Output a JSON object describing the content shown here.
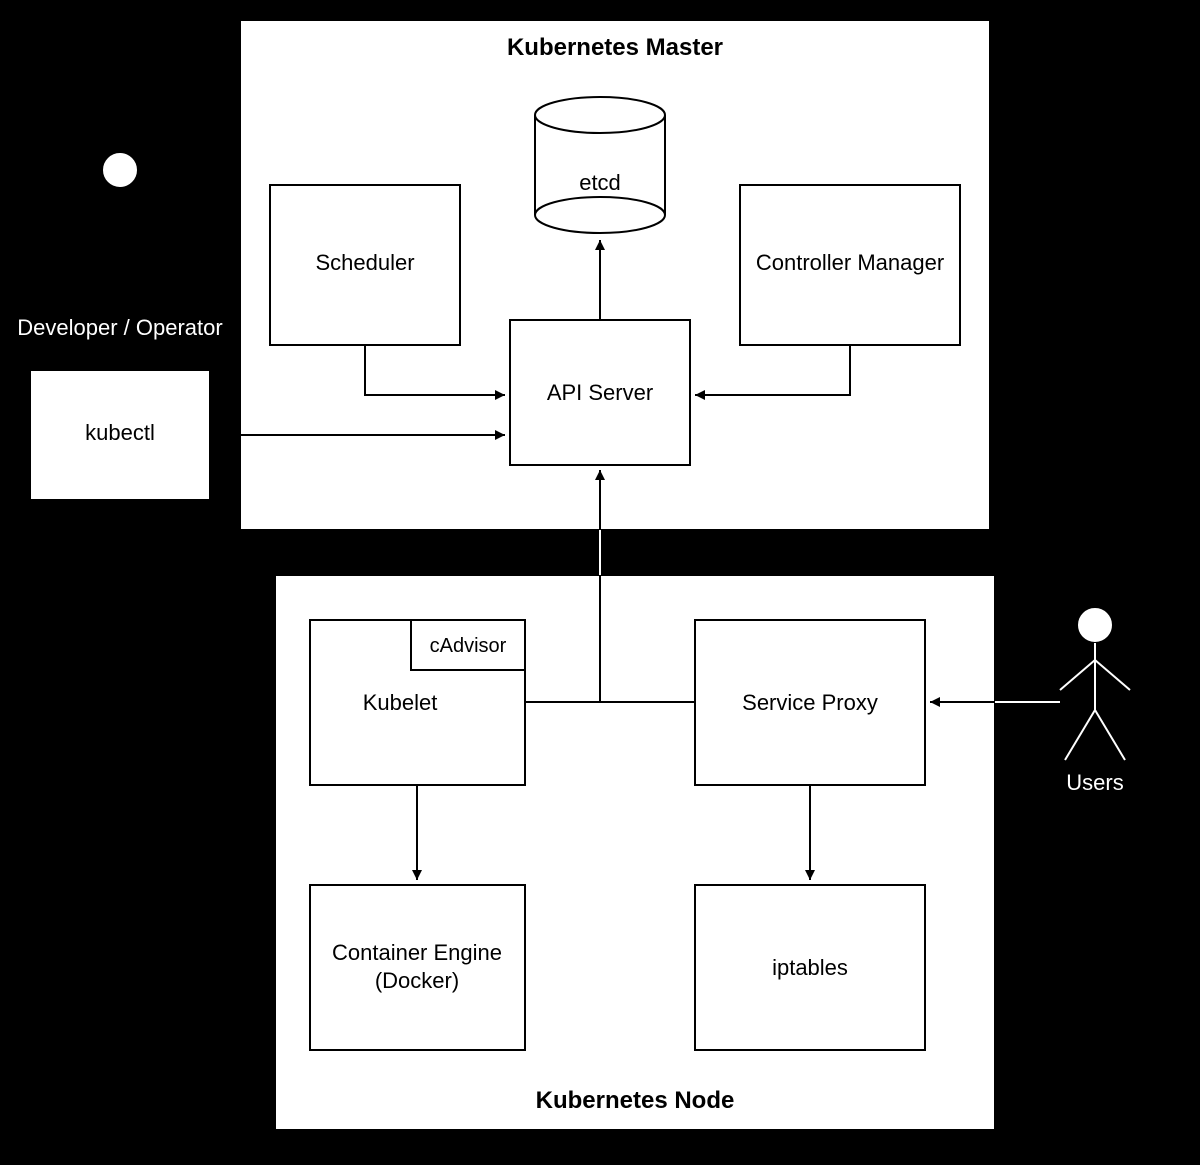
{
  "diagram": {
    "master_title": "Kubernetes Master",
    "node_title": "Kubernetes Node",
    "components": {
      "etcd": "etcd",
      "scheduler": "Scheduler",
      "controller_manager": "Controller Manager",
      "api_server": "API Server",
      "kubectl": "kubectl",
      "kubelet": "Kubelet",
      "cadvisor": "cAdvisor",
      "service_proxy": "Service Proxy",
      "container_engine_1": "Container Engine",
      "container_engine_2": "(Docker)",
      "iptables": "iptables"
    },
    "actors": {
      "developer": "Developer / Operator",
      "users": "Users"
    },
    "connections": [
      {
        "from": "developer",
        "to": "kubectl",
        "arrow": "to"
      },
      {
        "from": "kubectl",
        "to": "api_server",
        "arrow": "to"
      },
      {
        "from": "scheduler",
        "to": "api_server",
        "arrow": "to"
      },
      {
        "from": "controller_manager",
        "to": "api_server",
        "arrow": "to"
      },
      {
        "from": "api_server",
        "to": "etcd",
        "arrow": "to"
      },
      {
        "from": "kubelet",
        "to": "api_server",
        "arrow": "both_via_line"
      },
      {
        "from": "kubelet",
        "to": "container_engine",
        "arrow": "to"
      },
      {
        "from": "service_proxy",
        "to": "iptables",
        "arrow": "to"
      },
      {
        "from": "users",
        "to": "service_proxy",
        "arrow": "to"
      },
      {
        "from": "kubelet",
        "to": "service_proxy",
        "arrow": "line"
      }
    ]
  }
}
